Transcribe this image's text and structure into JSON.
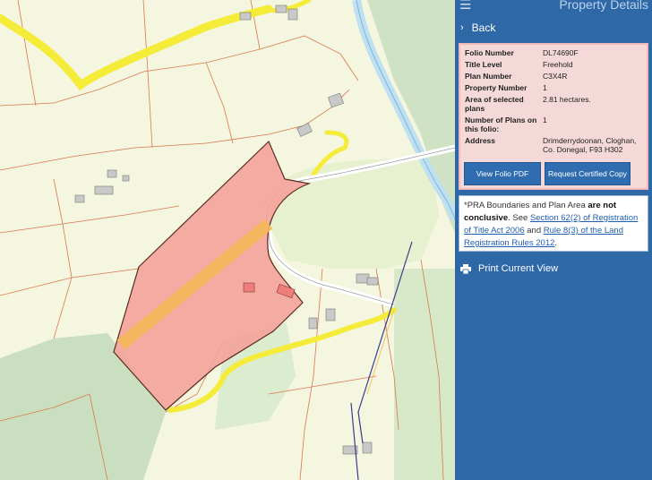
{
  "panel": {
    "title": "Property Details",
    "back_label": "Back",
    "print_label": "Print Current View",
    "icons": {
      "menu": "menu-icon",
      "back": "chevron-right-icon",
      "print": "printer-icon"
    }
  },
  "details": {
    "rows": [
      {
        "label": "Folio Number",
        "value": "DL74690F"
      },
      {
        "label": "Title Level",
        "value": "Freehold"
      },
      {
        "label": "Plan Number",
        "value": "C3X4R"
      },
      {
        "label": "Property Number",
        "value": "1"
      },
      {
        "label": "Area of selected plans",
        "value": "2.81 hectares."
      },
      {
        "label": "Number of Plans on this folio:",
        "value": "1"
      },
      {
        "label": "Address",
        "value": "Drimderrydoonan, Cloghan, Co. Donegal, F93 H302"
      }
    ],
    "view_pdf_label": "View Folio PDF",
    "certified_copy_label": "Request Certified Copy"
  },
  "note": {
    "prefix": "*PRA Boundaries and Plan Area ",
    "bold": "are not conclusive",
    "mid1": ". See ",
    "link1": "Section 62(2) of Registration of Title Act 2006",
    "mid2": " and ",
    "link2": "Rule 8(3) of the Land Registration Rules 2012",
    "suffix": "."
  },
  "colors": {
    "panel_bg": "#2e68a6",
    "card_bg": "#f5d9d9",
    "button_bg": "#2f6db0",
    "parcel_fill": "#f4a39a",
    "road": "#f5ec3a",
    "field": "#f4f6df",
    "woodland": "#cfe3c4",
    "river": "#bfe0f0"
  }
}
